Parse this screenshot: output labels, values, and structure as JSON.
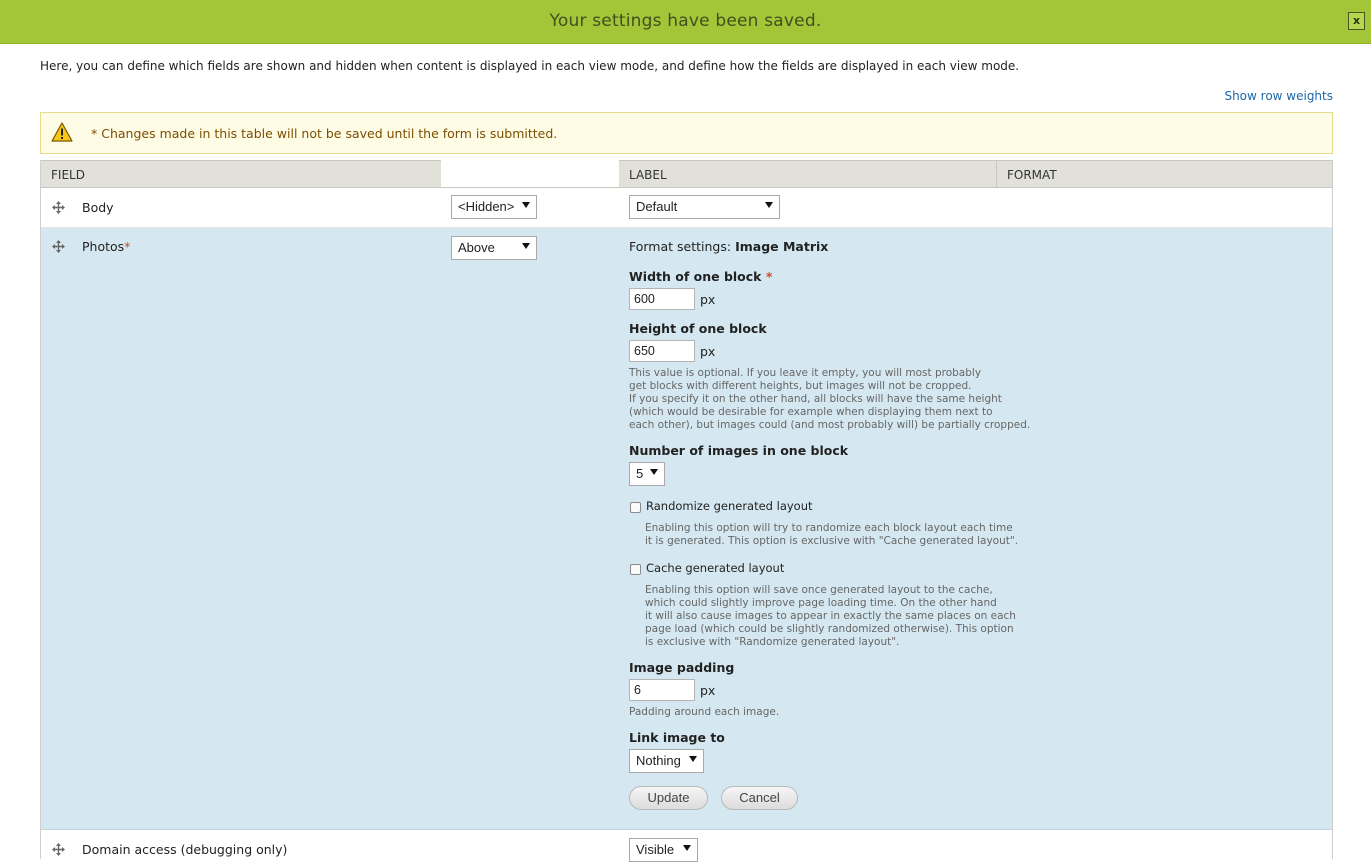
{
  "banner": {
    "message": "Your settings have been saved.",
    "close_label": "x"
  },
  "intro": "Here, you can define which fields are shown and hidden when content is displayed in each view mode, and define how the fields are displayed in each view mode.",
  "show_row_weights": "Show row weights",
  "warning": {
    "text": "* Changes made in this table will not be saved until the form is submitted.",
    "icon": "warning-icon"
  },
  "table": {
    "headers": {
      "field": "FIELD",
      "label": "LABEL",
      "format": "FORMAT"
    },
    "rows": {
      "body": {
        "name": "Body",
        "label_select": "<Hidden>",
        "format_select": "Default"
      },
      "photos": {
        "name": "Photos",
        "required_mark": "*",
        "label_select": "Above",
        "format_settings_prefix": "Format settings:",
        "format_settings_name": "Image Matrix",
        "width": {
          "label": "Width of one block",
          "required": "*",
          "value": "600",
          "unit": "px"
        },
        "height": {
          "label": "Height of one block",
          "value": "650",
          "unit": "px",
          "help": "This value is optional. If you leave it empty, you will most probably\nget blocks with different heights, but images will not be cropped.\nIf you specify it on the other hand, all blocks will have the same height\n(which would be desirable for example when displaying them next to\neach other), but images could (and most probably will) be partially cropped."
        },
        "num_images": {
          "label": "Number of images in one block",
          "value": "5"
        },
        "randomize": {
          "label": "Randomize generated layout",
          "checked": false,
          "help": "Enabling this option will try to randomize each block layout each time\nit is generated. This option is exclusive with \"Cache generated layout\"."
        },
        "cache": {
          "label": "Cache generated layout",
          "checked": false,
          "help": "Enabling this option will save once generated layout to the cache,\nwhich could slightly improve page loading time. On the other hand\nit will also cause images to appear in exactly the same places on each\npage load (which could be slightly randomized otherwise). This option\nis exclusive with \"Randomize generated layout\"."
        },
        "padding": {
          "label": "Image padding",
          "value": "6",
          "unit": "px",
          "help": "Padding around each image."
        },
        "link": {
          "label": "Link image to",
          "value": "Nothing"
        },
        "update_label": "Update",
        "cancel_label": "Cancel"
      },
      "domain": {
        "name": "Domain access (debugging only)",
        "format_select": "Visible"
      }
    }
  },
  "colors": {
    "banner": "#a2c638",
    "highlight_row": "#d5e8f1",
    "link": "#1d67a8",
    "warning_bg": "#fffce5"
  }
}
